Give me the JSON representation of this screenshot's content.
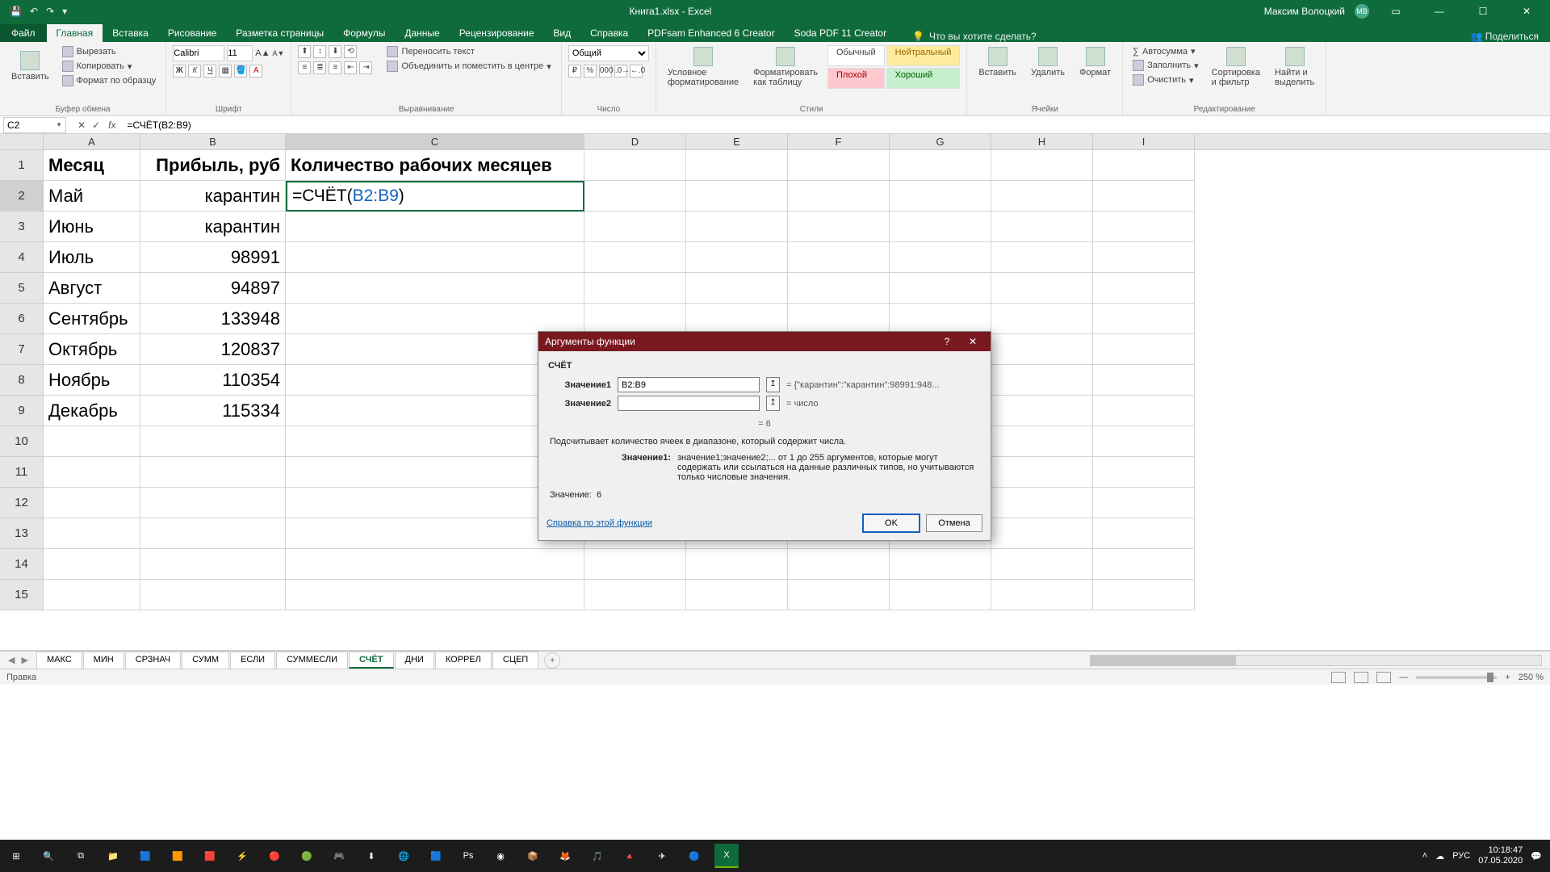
{
  "title": {
    "document": "Книга1.xlsx - Excel",
    "user": "Максим Волоцкий",
    "avatar": "МВ"
  },
  "qat": {
    "save": "💾",
    "undo": "↶",
    "redo": "↷",
    "more": "▾"
  },
  "tabs": {
    "file": "Файл",
    "home": "Главная",
    "insert": "Вставка",
    "draw": "Рисование",
    "layout": "Разметка страницы",
    "formulas": "Формулы",
    "data": "Данные",
    "review": "Рецензирование",
    "view": "Вид",
    "help": "Справка",
    "pdfsam": "PDFsam Enhanced 6 Creator",
    "soda": "Soda PDF 11 Creator",
    "tell": "Что вы хотите сделать?",
    "share": "Поделиться"
  },
  "ribbon": {
    "clipboard": {
      "paste": "Вставить",
      "cut": "Вырезать",
      "copy": "Копировать",
      "painter": "Формат по образцу",
      "label": "Буфер обмена"
    },
    "font": {
      "name": "Calibri",
      "size": "11",
      "label": "Шрифт"
    },
    "align": {
      "wrap": "Переносить текст",
      "merge": "Объединить и поместить в центре",
      "label": "Выравнивание"
    },
    "number": {
      "format": "Общий",
      "label": "Число"
    },
    "styles": {
      "cond": "Условное\nформатирование",
      "table": "Форматировать\nкак таблицу",
      "normal": "Обычный",
      "neutral": "Нейтральный",
      "bad": "Плохой",
      "good": "Хороший",
      "label": "Стили"
    },
    "cells": {
      "insert": "Вставить",
      "delete": "Удалить",
      "format": "Формат",
      "label": "Ячейки"
    },
    "editing": {
      "autosum": "Автосумма",
      "fill": "Заполнить",
      "clear": "Очистить",
      "sort": "Сортировка\nи фильтр",
      "find": "Найти и\nвыделить",
      "label": "Редактирование"
    }
  },
  "namebox": "C2",
  "formula": "=СЧЁТ(B2:B9)",
  "formula_display_prefix": "=СЧЁТ(",
  "formula_display_range": "B2:B9",
  "formula_display_suffix": ")",
  "columns": [
    "A",
    "B",
    "C",
    "D",
    "E",
    "F",
    "G",
    "H",
    "I"
  ],
  "table": {
    "headers": {
      "A": "Месяц",
      "B": "Прибыль, руб",
      "C": "Количество рабочих месяцев"
    },
    "rows": [
      {
        "A": "Май",
        "B": "карантин"
      },
      {
        "A": "Июнь",
        "B": "карантин"
      },
      {
        "A": "Июль",
        "B": "98991"
      },
      {
        "A": "Август",
        "B": "94897"
      },
      {
        "A": "Сентябрь",
        "B": "133948"
      },
      {
        "A": "Октябрь",
        "B": "120837"
      },
      {
        "A": "Ноябрь",
        "B": "110354"
      },
      {
        "A": "Декабрь",
        "B": "115334"
      }
    ]
  },
  "sheets": [
    "МАКС",
    "МИН",
    "СРЗНАЧ",
    "СУММ",
    "ЕСЛИ",
    "СУММЕСЛИ",
    "СЧЁТ",
    "ДНИ",
    "КОРРЕЛ",
    "СЦЕП"
  ],
  "active_sheet": "СЧЁТ",
  "status": {
    "mode": "Правка",
    "zoom": "250 %"
  },
  "dialog": {
    "title": "Аргументы функции",
    "fn": "СЧЁТ",
    "arg1_label": "Значение1",
    "arg1_value": "B2:B9",
    "arg1_eval": "= {\"карантин\":\"карантин\":98991:948...",
    "arg2_label": "Значение2",
    "arg2_value": "",
    "arg2_eval": "= число",
    "eq_result": "=  6",
    "desc": "Подсчитывает количество ячеек в диапазоне, который содержит числа.",
    "argdesc_label": "Значение1:",
    "argdesc_text": "значение1;значение2;... от 1 до 255 аргументов, которые могут содержать или ссылаться на данные различных типов, но учитываются только числовые значения.",
    "result_label": "Значение:",
    "result_value": "6",
    "help": "Справка по этой функции",
    "ok": "OK",
    "cancel": "Отмена"
  },
  "taskbar": {
    "lang": "РУС",
    "time": "10:18:47",
    "date": "07.05.2020"
  }
}
